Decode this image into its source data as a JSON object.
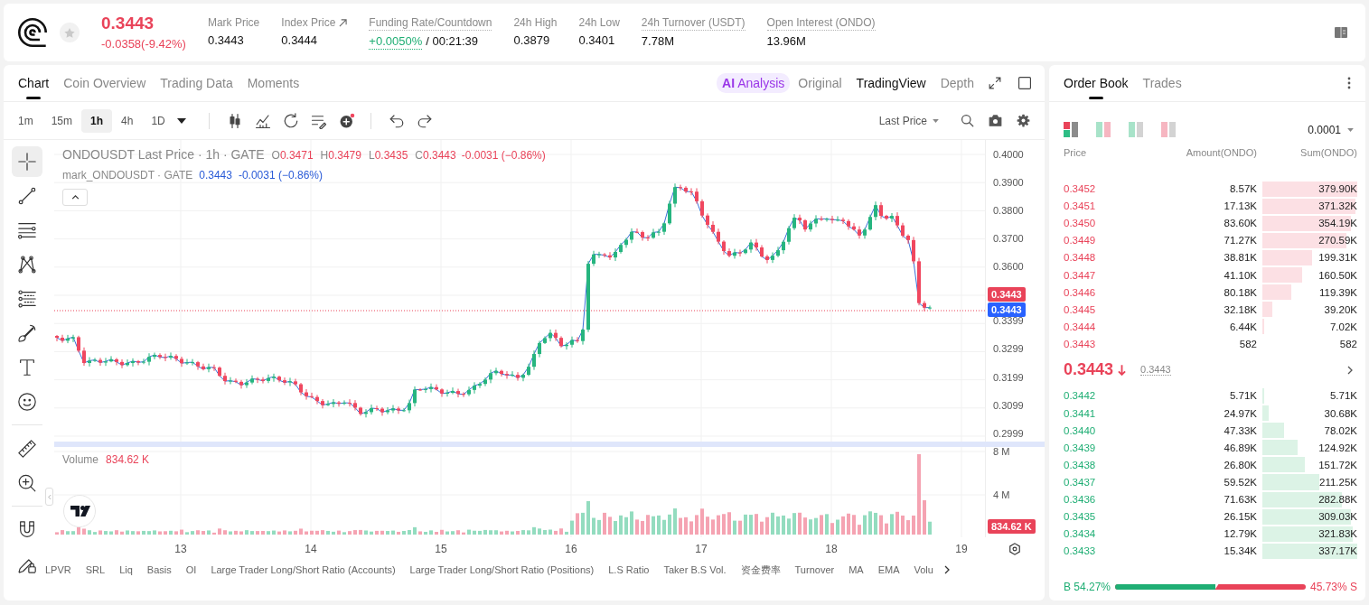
{
  "header": {
    "price": "0.3443",
    "change": "-0.0358(-9.42%)",
    "favorite": false,
    "stats": [
      {
        "label": "Mark Price",
        "value": "0.3443",
        "hint": false,
        "kind": "plain"
      },
      {
        "label": "Index Price",
        "value": "0.3444",
        "hint": false,
        "kind": "link"
      },
      {
        "label": "Funding Rate/Countdown",
        "value": "+0.0050%",
        "countdown": "/ 00:21:39",
        "hint": true,
        "kind": "funding"
      },
      {
        "label": "24h High",
        "value": "0.3879",
        "hint": false,
        "kind": "plain"
      },
      {
        "label": "24h Low",
        "value": "0.3401",
        "hint": false,
        "kind": "plain"
      },
      {
        "label": "24h Turnover (USDT)",
        "value": "7.78M",
        "hint": true,
        "kind": "plain"
      },
      {
        "label": "Open Interest (ONDO)",
        "value": "13.96M",
        "hint": true,
        "kind": "plain"
      }
    ]
  },
  "chart_panel": {
    "tabs": [
      {
        "label": "Chart",
        "selected": true
      },
      {
        "label": "Coin Overview",
        "selected": false
      },
      {
        "label": "Trading Data",
        "selected": false
      },
      {
        "label": "Moments",
        "selected": false
      }
    ],
    "views": [
      {
        "kind": "ai",
        "badge": "AI",
        "label": "Analysis",
        "selected": false
      },
      {
        "kind": "text",
        "label": "Original",
        "selected": false
      },
      {
        "kind": "text",
        "label": "TradingView",
        "selected": true
      },
      {
        "kind": "text",
        "label": "Depth",
        "selected": false
      }
    ],
    "intervals": [
      {
        "label": "1m",
        "selected": false
      },
      {
        "label": "15m",
        "selected": false
      },
      {
        "label": "1h",
        "selected": true
      },
      {
        "label": "4h",
        "selected": false
      },
      {
        "label": "1D",
        "selected": false
      }
    ],
    "price_source": "Last Price",
    "drawing_tools": [
      {
        "selected": true
      },
      {
        "selected": false
      },
      {
        "selected": false
      },
      {
        "selected": false
      },
      {
        "selected": false
      },
      {
        "selected": false
      },
      {
        "selected": false
      },
      {
        "selected": false
      },
      {
        "selected": false
      },
      {
        "selected": false
      },
      {
        "selected": false
      },
      {
        "selected": false
      }
    ],
    "legend": {
      "symbol": "ONDOUSDT Last Price · 1h · GATE",
      "ohlc": [
        {
          "key": "O",
          "value": "0.3471"
        },
        {
          "key": "H",
          "value": "0.3479"
        },
        {
          "key": "L",
          "value": "0.3435"
        },
        {
          "key": "C",
          "value": "0.3443"
        }
      ],
      "change": "-0.0031 (−0.86%)",
      "mark_symbol": "mark_ONDOUSDT · GATE",
      "mark_price": "0.3443",
      "mark_change": "-0.0031 (−0.86%)"
    },
    "price_axis": {
      "upper": [
        "0.4000",
        "0.3900",
        "0.3800",
        "0.3700",
        "0.3600"
      ],
      "lower": [
        "0.3399",
        "0.3299",
        "0.3199",
        "0.3099",
        "0.2999"
      ]
    },
    "last_price_tag": "0.3443",
    "mark_price_tag": "0.3443",
    "volume": {
      "title": "Volume",
      "value": "834.62 K",
      "axis": [
        "8 M",
        "4 M"
      ],
      "tag": "834.62 K"
    },
    "time_axis": [
      "13",
      "14",
      "15",
      "16",
      "17",
      "18",
      "19"
    ],
    "indicators": [
      "LPVR",
      "SRL",
      "Liq",
      "Basis",
      "OI",
      "Large Trader Long/Short Ratio (Accounts)",
      "Large Trader Long/Short Ratio (Positions)",
      "L.S Ratio",
      "Taker B.S Vol.",
      "资金费率",
      "Turnover",
      "MA",
      "EMA",
      "Volu"
    ]
  },
  "order_book": {
    "tabs": [
      {
        "label": "Order Book",
        "selected": true
      },
      {
        "label": "Trades",
        "selected": false
      }
    ],
    "layouts": [
      {
        "selected": true
      },
      {
        "selected": false
      },
      {
        "selected": false
      },
      {
        "selected": false
      }
    ],
    "precision": "0.0001",
    "columns": [
      "Price",
      "Amount(ONDO)",
      "Sum(ONDO)"
    ],
    "asks": [
      {
        "price": "0.3452",
        "amount": "8.57K",
        "sum": "379.90K",
        "level": 1.0
      },
      {
        "price": "0.3451",
        "amount": "17.13K",
        "sum": "371.32K",
        "level": 0.98
      },
      {
        "price": "0.3450",
        "amount": "83.60K",
        "sum": "354.19K",
        "level": 0.93
      },
      {
        "price": "0.3449",
        "amount": "71.27K",
        "sum": "270.59K",
        "level": 0.89
      },
      {
        "price": "0.3448",
        "amount": "38.81K",
        "sum": "199.31K",
        "level": 0.52
      },
      {
        "price": "0.3447",
        "amount": "41.10K",
        "sum": "160.50K",
        "level": 0.42
      },
      {
        "price": "0.3446",
        "amount": "80.18K",
        "sum": "119.39K",
        "level": 0.3
      },
      {
        "price": "0.3445",
        "amount": "32.18K",
        "sum": "39.20K",
        "level": 0.1
      },
      {
        "price": "0.3444",
        "amount": "6.44K",
        "sum": "7.02K",
        "level": 0.02
      },
      {
        "price": "0.3443",
        "amount": "582",
        "sum": "582"
      }
    ],
    "mid": {
      "price": "0.3443",
      "falling": true,
      "mark": "0.3443"
    },
    "bids": [
      {
        "price": "0.3442",
        "amount": "5.71K",
        "sum": "5.71K",
        "level": 0.02
      },
      {
        "price": "0.3441",
        "amount": "24.97K",
        "sum": "30.68K",
        "level": 0.07
      },
      {
        "price": "0.3440",
        "amount": "47.33K",
        "sum": "78.02K",
        "level": 0.23
      },
      {
        "price": "0.3439",
        "amount": "46.89K",
        "sum": "124.92K",
        "level": 0.37
      },
      {
        "price": "0.3438",
        "amount": "26.80K",
        "sum": "151.72K",
        "level": 0.45
      },
      {
        "price": "0.3437",
        "amount": "59.52K",
        "sum": "211.25K",
        "level": 0.6
      },
      {
        "price": "0.3436",
        "amount": "71.63K",
        "sum": "282.88K",
        "level": 0.84
      },
      {
        "price": "0.3435",
        "amount": "26.15K",
        "sum": "309.03K",
        "level": 0.93
      },
      {
        "price": "0.3434",
        "amount": "12.79K",
        "sum": "321.83K",
        "level": 0.95
      },
      {
        "price": "0.3433",
        "amount": "15.34K",
        "sum": "337.17K",
        "level": 1.0
      }
    ],
    "ratio": {
      "buy": "B 54.27%",
      "sell": "45.73% S",
      "level": 0.5427
    }
  }
}
